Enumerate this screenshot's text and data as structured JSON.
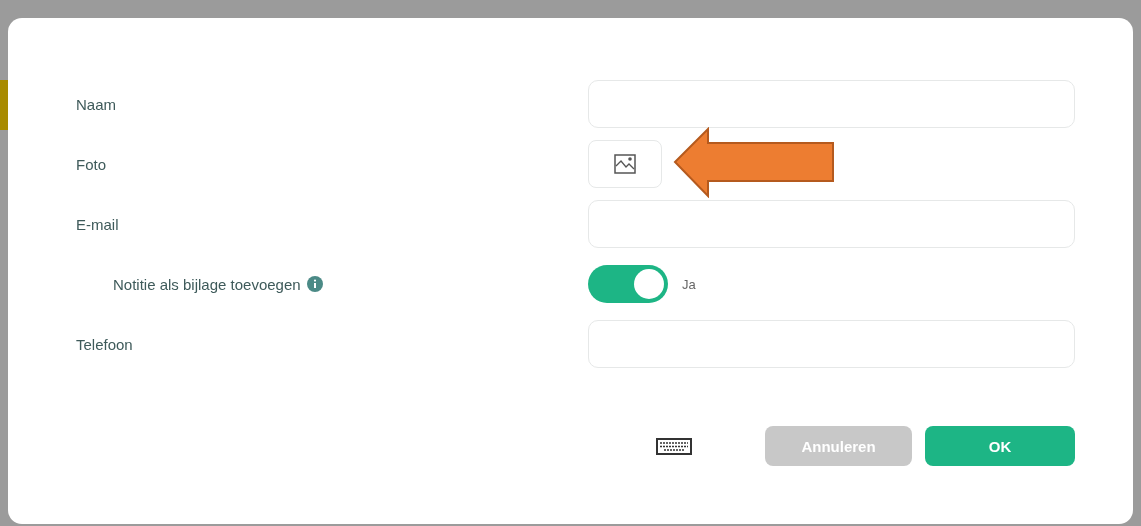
{
  "fields": [
    {
      "kind": "text",
      "label": "Naam"
    },
    {
      "kind": "photo",
      "label": "Foto"
    },
    {
      "kind": "text",
      "label": "E-mail",
      "children": [
        {
          "kind": "toggle",
          "label": "Notitie als bijlage toevoegen",
          "info": true,
          "on": true,
          "value_label": "Ja"
        }
      ]
    },
    {
      "kind": "text",
      "label": "Telefoon"
    }
  ],
  "buttons": [
    {
      "label": "Annuleren",
      "disabled": true
    },
    {
      "label": "OK",
      "disabled": false
    }
  ]
}
